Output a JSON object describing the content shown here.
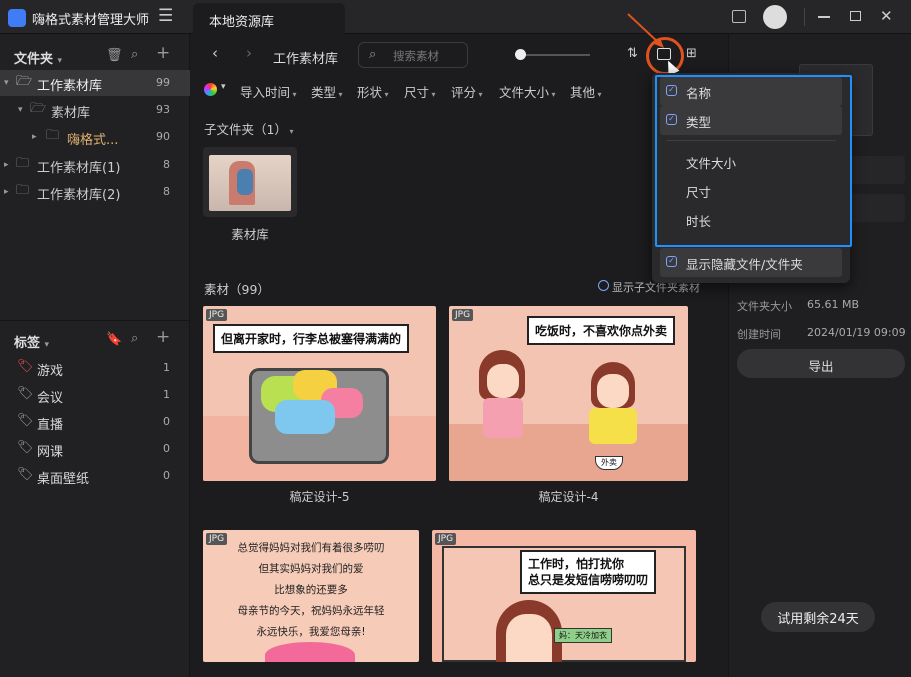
{
  "app": {
    "title": "嗨格式素材管理大师",
    "tab": "本地资源库"
  },
  "colors": {
    "accent": "#1e90ff",
    "highlight": "#e0531e"
  },
  "sidebar": {
    "folders_header": "文件夹",
    "tree": [
      {
        "label": "工作素材库",
        "count": "99"
      },
      {
        "label": "素材库",
        "count": "93"
      },
      {
        "label": "嗨格式...",
        "count": "90"
      },
      {
        "label": "工作素材库(1)",
        "count": "8"
      },
      {
        "label": "工作素材库(2)",
        "count": "8"
      }
    ],
    "tags_header": "标签",
    "tags": [
      {
        "label": "游戏",
        "count": "1"
      },
      {
        "label": "会议",
        "count": "1"
      },
      {
        "label": "直播",
        "count": "0"
      },
      {
        "label": "网课",
        "count": "0"
      },
      {
        "label": "桌面壁纸",
        "count": "0"
      }
    ]
  },
  "main": {
    "breadcrumb": "工作素材库",
    "search_placeholder": "搜索素材",
    "filters": [
      "导入时间",
      "类型",
      "形状",
      "尺寸",
      "评分",
      "文件大小",
      "其他"
    ],
    "subfolders_label": "子文件夹（1）",
    "subfolder_name": "素材库",
    "materials_label": "素材（99）",
    "show_sub_label": "显示子文件夹素材",
    "badge": "JPG",
    "cards": [
      {
        "caption": "稿定设计-5",
        "bubble": "但离开家时，行李总被塞得满满的"
      },
      {
        "caption": "稿定设计-4",
        "bubble": "吃饭时，不喜欢你点外卖",
        "bowl": "外卖"
      },
      {
        "lines": [
          "总觉得妈妈对我们有着很多唠叨",
          "但其实妈妈对我们的爱",
          "比想象的还要多",
          "母亲节的今天，祝妈妈永远年轻",
          "永远快乐，我爱您母亲!"
        ]
      },
      {
        "bubble1": "工作时，怕打扰你",
        "bubble2": "总只是发短信唠唠叨叨",
        "phone": "妈：天冷加衣"
      }
    ]
  },
  "menu": {
    "items": [
      {
        "label": "名称",
        "checked": true
      },
      {
        "label": "类型",
        "checked": true
      },
      {
        "label": "文件大小",
        "checked": false
      },
      {
        "label": "尺寸",
        "checked": false
      },
      {
        "label": "时长",
        "checked": false
      }
    ],
    "hidden_label": "显示隐藏文件/文件夹"
  },
  "right": {
    "size_label": "文件夹大小",
    "size_value": "65.61 MB",
    "created_label": "创建时间",
    "created_value": "2024/01/19 09:09",
    "export_label": "导出",
    "trial_label": "试用剩余24天"
  }
}
